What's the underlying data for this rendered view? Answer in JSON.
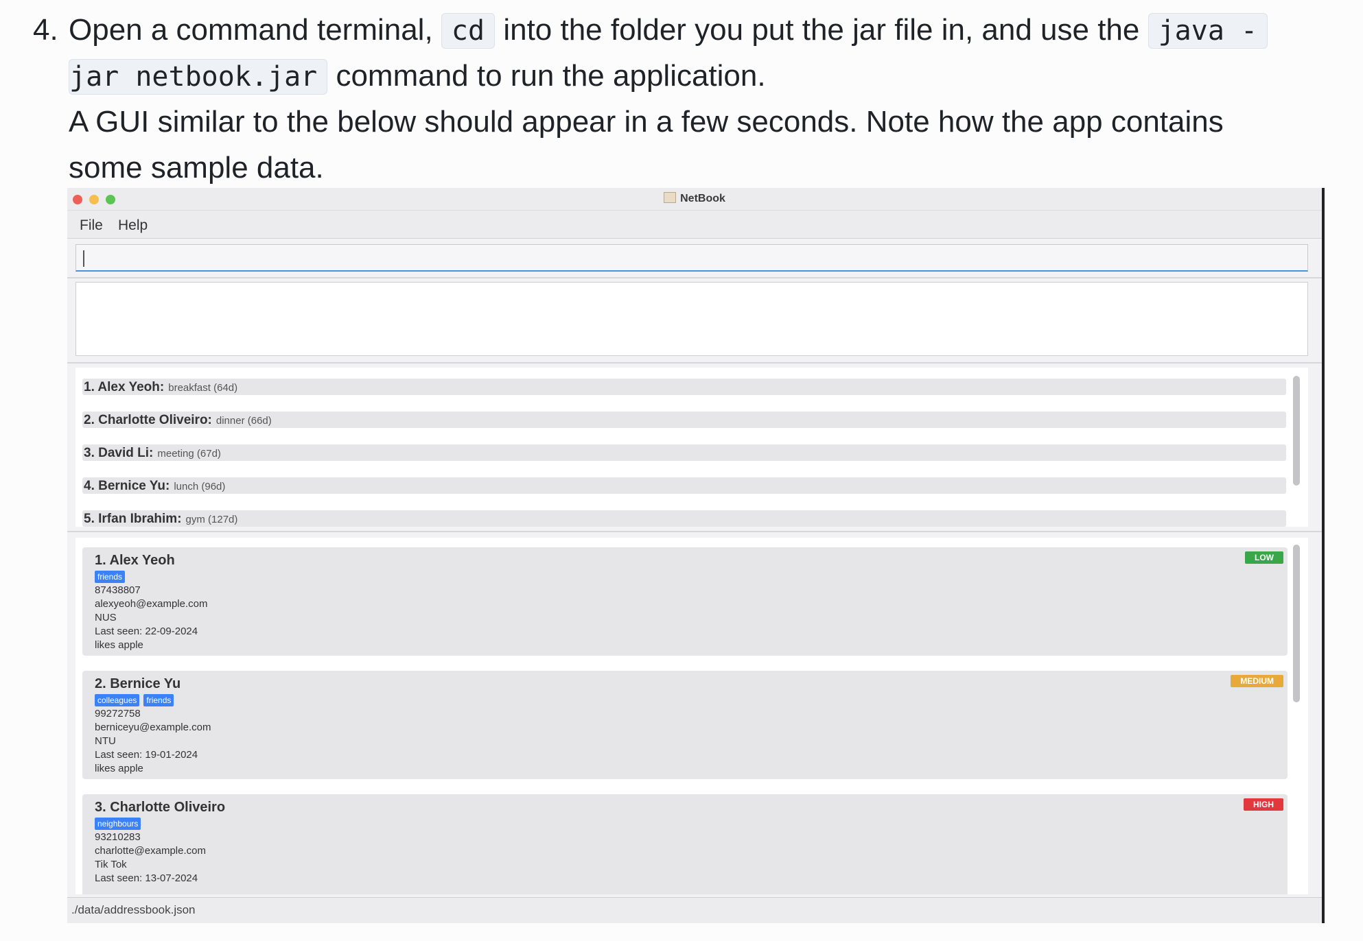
{
  "instruction": {
    "number": "4.",
    "line1_part1": "Open a command terminal, ",
    "code_cd": "cd",
    "line1_part2": " into the folder you put the jar file in, and use the ",
    "code_java_1": "java -",
    "code_java_2": "jar netbook.jar",
    "line2_part2": " command to run the application.",
    "line3": "A GUI similar to the below should appear in a few seconds. Note how the app contains",
    "line4": "some sample data."
  },
  "app": {
    "window_title": "NetBook",
    "menu": [
      "File",
      "Help"
    ],
    "command_input": "",
    "result_text": "",
    "events": [
      {
        "name": "1.  Alex Yeoh:",
        "desc": "breakfast (64d)"
      },
      {
        "name": "2.  Charlotte Oliveiro:",
        "desc": "dinner (66d)"
      },
      {
        "name": "3.  David Li:",
        "desc": "meeting (67d)"
      },
      {
        "name": "4.  Bernice Yu:",
        "desc": "lunch (96d)"
      },
      {
        "name": "5.  Irfan Ibrahim:",
        "desc": "gym (127d)"
      }
    ],
    "persons": [
      {
        "name": "1. Alex Yeoh",
        "tags": [
          "friends"
        ],
        "phone": "87438807",
        "email": "alexyeoh@example.com",
        "organization": "NUS",
        "last_seen": "Last seen: 22-09-2024",
        "remark": "likes apple",
        "priority": "LOW",
        "priority_color": "#3aa64a"
      },
      {
        "name": "2. Bernice Yu",
        "tags": [
          "colleagues",
          "friends"
        ],
        "phone": "99272758",
        "email": "berniceyu@example.com",
        "organization": "NTU",
        "last_seen": "Last seen: 19-01-2024",
        "remark": "likes apple",
        "priority": "MEDIUM",
        "priority_color": "#e8a93a"
      },
      {
        "name": "3. Charlotte Oliveiro",
        "tags": [
          "neighbours"
        ],
        "phone": "93210283",
        "email": "charlotte@example.com",
        "organization": "Tik Tok",
        "last_seen": "Last seen: 13-07-2024",
        "remark": "",
        "priority": "HIGH",
        "priority_color": "#e2373d"
      }
    ],
    "status_path": "./data/addressbook.json"
  },
  "colors": {
    "tag_blue": "#3b82f6",
    "input_focus": "#4a90d9"
  }
}
